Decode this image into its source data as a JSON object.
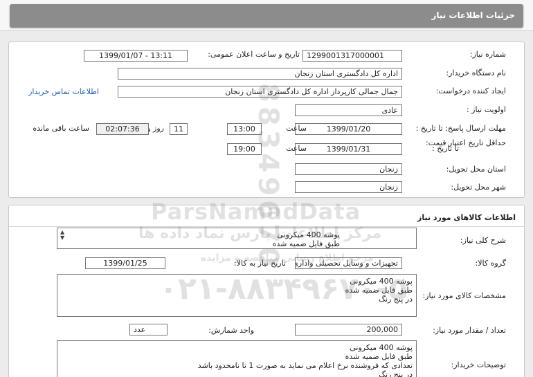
{
  "header": {
    "title": "جزئیات اطلاعات نیاز"
  },
  "need_info": {
    "need_number_label": "شماره نیاز:",
    "need_number": "1299001317000001",
    "announce_label": "تاریخ و ساعت اعلان عمومی:",
    "announce_value": "1399/01/07 - 13:11",
    "buyer_org_label": "نام دستگاه خریدار:",
    "buyer_org": "اداره کل دادگستری استان زنجان",
    "creator_label": "ایجاد کننده درخواست:",
    "creator": "جمال جمالی کارپرداز اداره کل دادگستری استان زنجان",
    "contact_link": "اطلاعات تماس خریدار",
    "priority_label": "اولویت نیاز :",
    "priority": "عادی",
    "reply_deadline_label": "مهلت ارسال پاسخ: تا تاریخ :",
    "reply_date": "1399/01/20",
    "time_label": "ساعت",
    "reply_time": "13:00",
    "days_value": "11",
    "days_label": "روز و",
    "remaining_time": "02:07:36",
    "remaining_label": "ساعت باقی مانده",
    "validity_label": "حداقل تاریخ اعتبار قیمت:",
    "validity_to_label": "تا تاریخ :",
    "validity_date": "1399/01/31",
    "validity_time_label": "ساعت",
    "validity_time": "19:00",
    "province_label": "استان محل تحویل:",
    "province": "زنجان",
    "city_label": "شهر محل تحویل:",
    "city": "زنجان"
  },
  "goods": {
    "section_title": "اطلاعات کالاهای مورد نیاز",
    "summary_label": "شرح کلی نیاز:",
    "summary_lines": [
      "پوشه 400 میکرونی",
      "طبق فایل ضمیه شده"
    ],
    "group_label": "گروه کالا:",
    "group": "تجهیزات و وسایل تحصیلی واداری",
    "need_date_label": "تاریخ نیاز به کالا:",
    "need_date": "1399/01/25",
    "specs_label": "مشخصات کالای مورد نیاز:",
    "specs_lines": [
      "پوشه 400 میکرونی",
      "طبق فایل ضمیه شده",
      "در پنج رنگ"
    ],
    "qty_label": "تعداد / مقدار مورد نیاز:",
    "qty": "200,000",
    "unit_label": "واحد شمارش:",
    "unit": "عدد",
    "buyer_notes_label": "توضیحات خریدار:",
    "buyer_notes_lines": [
      "پوشه 400 میکرونی",
      "طبق فایل ضمیه شده",
      "تعدادی که فروشنده نرخ اعلام می نماید به صورت 1 تا نامحدود باشد",
      "در پنج رنگ"
    ]
  },
  "watermark": {
    "brand": "ParsNamadData",
    "tagline": "مرکز اطلاعات پارس نماد داده ها",
    "sub": "مرجع اطلاع رسانی مناقصه و مزایده",
    "phone": "۰۲۱-۸۸۳۴۹۶۷۰-۵",
    "vertical": "88349670"
  }
}
